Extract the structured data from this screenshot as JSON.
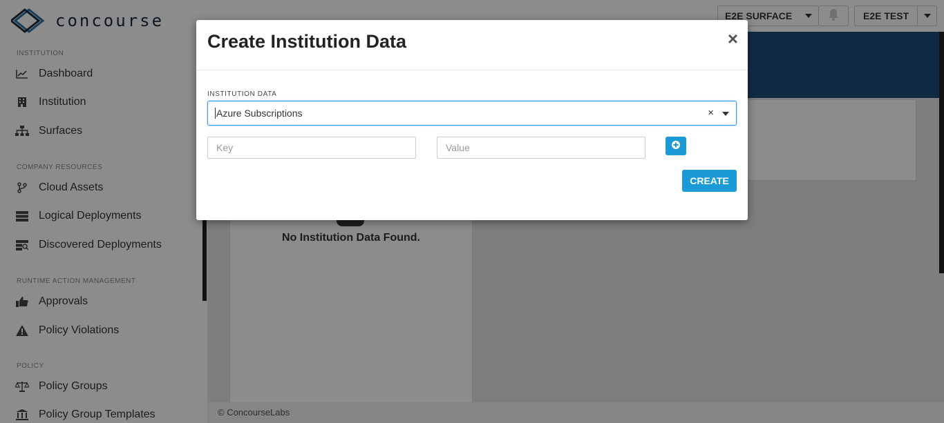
{
  "brand": {
    "name": "concourse"
  },
  "sidebar": {
    "sections": [
      {
        "title": "INSTITUTION",
        "items": [
          {
            "label": "Dashboard",
            "icon": "chart-line-icon"
          },
          {
            "label": "Institution",
            "icon": "building-icon"
          },
          {
            "label": "Surfaces",
            "icon": "sitemap-icon"
          }
        ]
      },
      {
        "title": "COMPANY RESOURCES",
        "items": [
          {
            "label": "Cloud Assets",
            "icon": "code-branch-icon"
          },
          {
            "label": "Logical Deployments",
            "icon": "server-icon"
          },
          {
            "label": "Discovered Deployments",
            "icon": "search-server-icon"
          }
        ]
      },
      {
        "title": "RUNTIME ACTION MANAGEMENT",
        "items": [
          {
            "label": "Approvals",
            "icon": "thumbs-up-icon"
          },
          {
            "label": "Policy Violations",
            "icon": "warning-icon"
          }
        ]
      },
      {
        "title": "POLICY",
        "items": [
          {
            "label": "Policy Groups",
            "icon": "balance-scale-icon"
          },
          {
            "label": "Policy Group Templates",
            "icon": "landmark-icon"
          }
        ]
      }
    ]
  },
  "topbar": {
    "surface_label": "E2E SURFACE",
    "institution_label": "E2E TEST"
  },
  "main": {
    "empty_text": "No Institution Data Found.",
    "footer": "© ConcourseLabs"
  },
  "modal": {
    "title": "Create Institution Data",
    "close_symbol": "×",
    "field_label": "INSTITUTION DATA",
    "selected_value": "Azure Subscriptions",
    "clear_symbol": "×",
    "key_placeholder": "Key",
    "value_placeholder": "Value",
    "create_label": "CREATE"
  },
  "colors": {
    "accent": "#1a9bd7",
    "banner": "#1f4d7c",
    "focus_border": "#3b99fc"
  }
}
